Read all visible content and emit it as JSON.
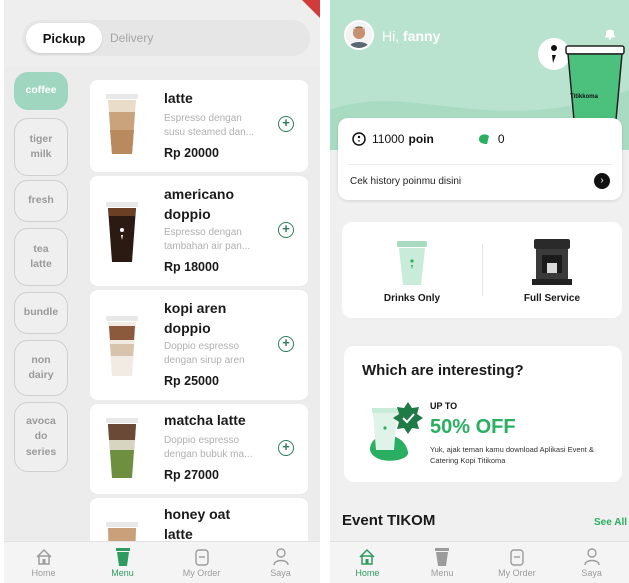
{
  "left": {
    "tabs": {
      "pickup": "Pickup",
      "delivery": "Delivery"
    },
    "categories": [
      {
        "label": "coffee",
        "active": true
      },
      {
        "label": "tiger\nmilk",
        "active": false
      },
      {
        "label": "fresh",
        "active": false
      },
      {
        "label": "tea\nlatte",
        "active": false
      },
      {
        "label": "bundle",
        "active": false
      },
      {
        "label": "non\ndairy",
        "active": false
      },
      {
        "label": "avoca\ndo\nseries",
        "active": false
      }
    ],
    "products": [
      {
        "name": "latte",
        "desc": "Espresso dengan susu steamed dan...",
        "price": "Rp 20000"
      },
      {
        "name": "americano\ndoppio",
        "desc": "Espresso dengan tambahan air pan...",
        "price": "Rp 18000"
      },
      {
        "name": "kopi aren\ndoppio",
        "desc": "Doppio espresso dengan sirup aren",
        "price": "Rp 25000"
      },
      {
        "name": "matcha latte",
        "desc": "Doppio espresso dengan bubuk ma...",
        "price": "Rp 27000"
      },
      {
        "name": "honey oat\nlatte",
        "desc": "",
        "price": ""
      }
    ],
    "nav": {
      "home": "Home",
      "menu": "Menu",
      "order": "My Order",
      "saya": "Saya"
    }
  },
  "right": {
    "greeting_prefix": "Hi,",
    "user_name": "fanny",
    "points_value": "11000",
    "points_label": "poin",
    "stamps_value": "0",
    "history_label": "Cek history poinmu disini",
    "cup_label": "Titikkoma",
    "services": {
      "drinks": "Drinks Only",
      "full": "Full Service"
    },
    "promo": {
      "title": "Which are interesting?",
      "upto": "UP TO",
      "off": "50% OFF",
      "desc": "Yuk, ajak teman kamu download Aplikasi Event & Catering Kopi Titikoma"
    },
    "event_title": "Event TIKOM",
    "see_all": "See All",
    "nav": {
      "home": "Home",
      "menu": "Menu",
      "order": "My Order",
      "saya": "Saya"
    }
  },
  "colors": {
    "accent_green": "#2aae61",
    "mint": "#b9e3cf",
    "category_active": "#9ed6bf",
    "corner_red": "#d23b3b"
  },
  "icons": [
    "home-icon",
    "cup-icon",
    "order-icon",
    "user-icon",
    "bell-icon",
    "coin-icon",
    "stamp-icon",
    "chevron-right-icon",
    "plus-circle-icon"
  ]
}
